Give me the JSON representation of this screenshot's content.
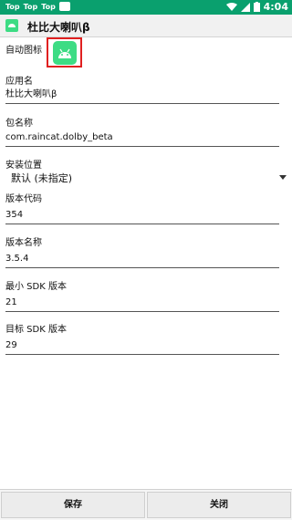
{
  "status_bar": {
    "notif_1": "Top",
    "notif_2": "Top",
    "notif_3": "Top",
    "time": "4:04"
  },
  "title_bar": {
    "title": "杜比大喇叭β"
  },
  "form": {
    "icon_label": "自动图标",
    "app_name_label": "应用名",
    "app_name_value": "杜比大喇叭β",
    "package_label": "包名称",
    "package_value": "com.raincat.dolby_beta",
    "install_location_label": "安装位置",
    "install_location_value": "默认 (未指定)",
    "version_code_label": "版本代码",
    "version_code_value": "354",
    "version_name_label": "版本名称",
    "version_name_value": "3.5.4",
    "min_sdk_label": "最小 SDK 版本",
    "min_sdk_value": "21",
    "target_sdk_label": "目标 SDK 版本",
    "target_sdk_value": "29"
  },
  "actions": {
    "save": "保存",
    "close": "关闭"
  },
  "colors": {
    "status_bar": "#0aa06e",
    "android_green": "#3ddc84",
    "highlight_red": "#e02020"
  },
  "icons": {
    "app": "android-icon",
    "wifi": "wifi-icon",
    "signal": "signal-icon",
    "battery": "battery-icon"
  }
}
